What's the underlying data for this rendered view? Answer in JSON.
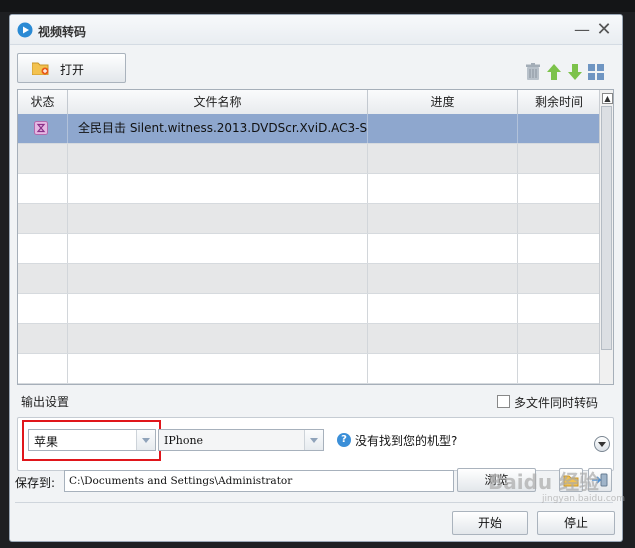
{
  "window": {
    "title": "视频转码"
  },
  "toolbar": {
    "open_label": "打开"
  },
  "table": {
    "columns": [
      "状态",
      "文件名称",
      "进度",
      "剩余时间"
    ],
    "rows": [
      {
        "status_icon": "hourglass-icon",
        "filename": "全民目击 Silent.witness.2013.DVDScr.XviD.AC3-S…",
        "progress": "",
        "remaining": ""
      }
    ]
  },
  "output": {
    "section_label": "输出设置",
    "multi_label": "多文件同时转码",
    "multi_checked": false,
    "brand_value": "苹果",
    "model_value": "IPhone",
    "help_text": "没有找到您的机型?"
  },
  "save": {
    "label": "保存到:",
    "path": "C:\\Documents and Settings\\Administrator",
    "browse_label": "浏览"
  },
  "actions": {
    "start_label": "开始",
    "stop_label": "停止"
  },
  "watermark": {
    "text": "Baidu 经验",
    "sub": "jingyan.baidu.com"
  },
  "colors": {
    "selected_row": "#8ea7ce",
    "highlight_box": "#e0161b",
    "accent": "#3b8fd8"
  }
}
